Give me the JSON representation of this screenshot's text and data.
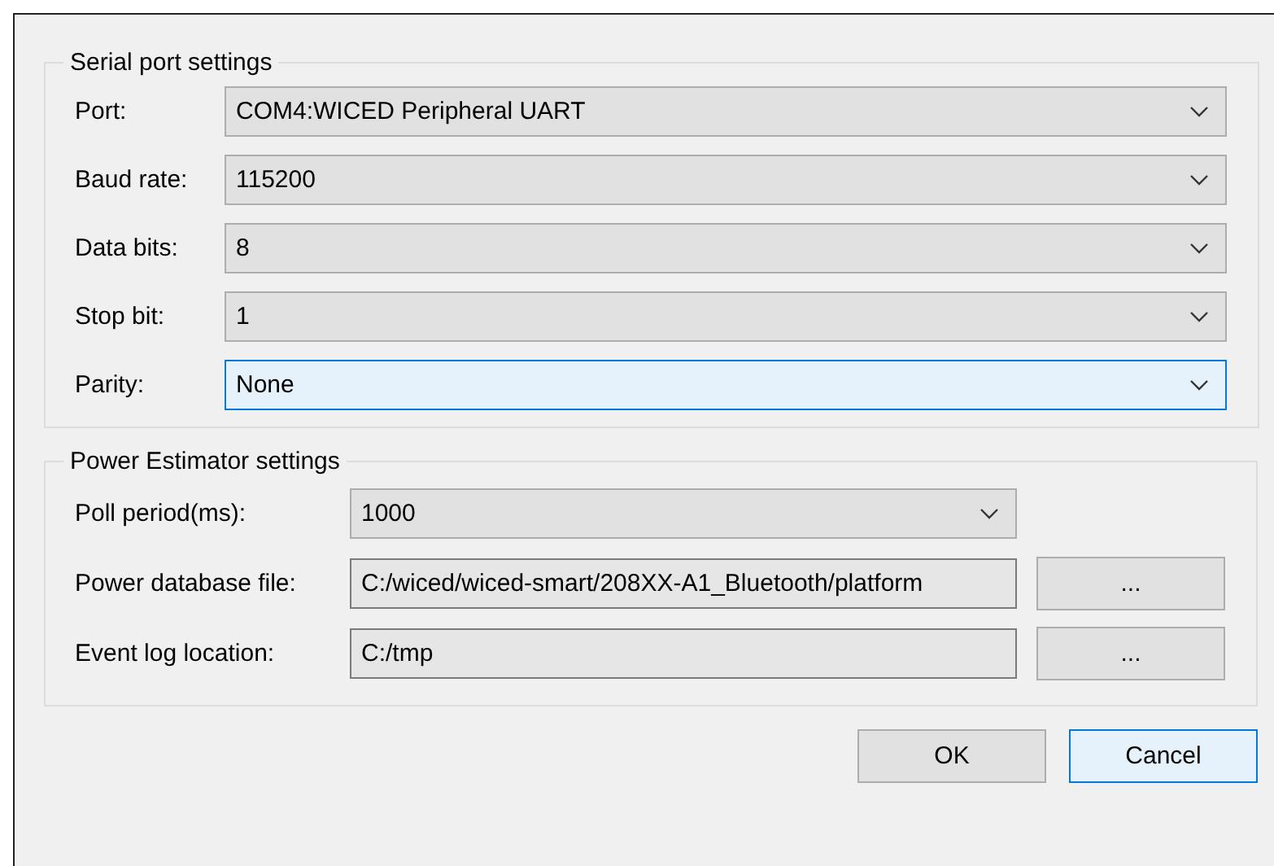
{
  "serial_group": {
    "title": "Serial port settings",
    "fields": [
      {
        "label": "Port:",
        "value": "COM4:WICED Peripheral UART",
        "focused": false
      },
      {
        "label": "Baud rate:",
        "value": "115200",
        "focused": false
      },
      {
        "label": "Data bits:",
        "value": "8",
        "focused": false
      },
      {
        "label": "Stop bit:",
        "value": "1",
        "focused": false
      },
      {
        "label": "Parity:",
        "value": "None",
        "focused": true
      }
    ]
  },
  "power_group": {
    "title": "Power Estimator settings",
    "fields": [
      {
        "kind": "dropdown",
        "label": "Poll period(ms):",
        "value": "1000"
      },
      {
        "kind": "file",
        "label": "Power database file:",
        "value": "C:/wiced/wiced-smart/208XX-A1_Bluetooth/platform",
        "button": "..."
      },
      {
        "kind": "file",
        "label": "Event log location:",
        "value": "C:/tmp",
        "button": "..."
      }
    ]
  },
  "buttons": [
    {
      "label": "OK",
      "focused": false
    },
    {
      "label": "Cancel",
      "focused": true
    }
  ]
}
